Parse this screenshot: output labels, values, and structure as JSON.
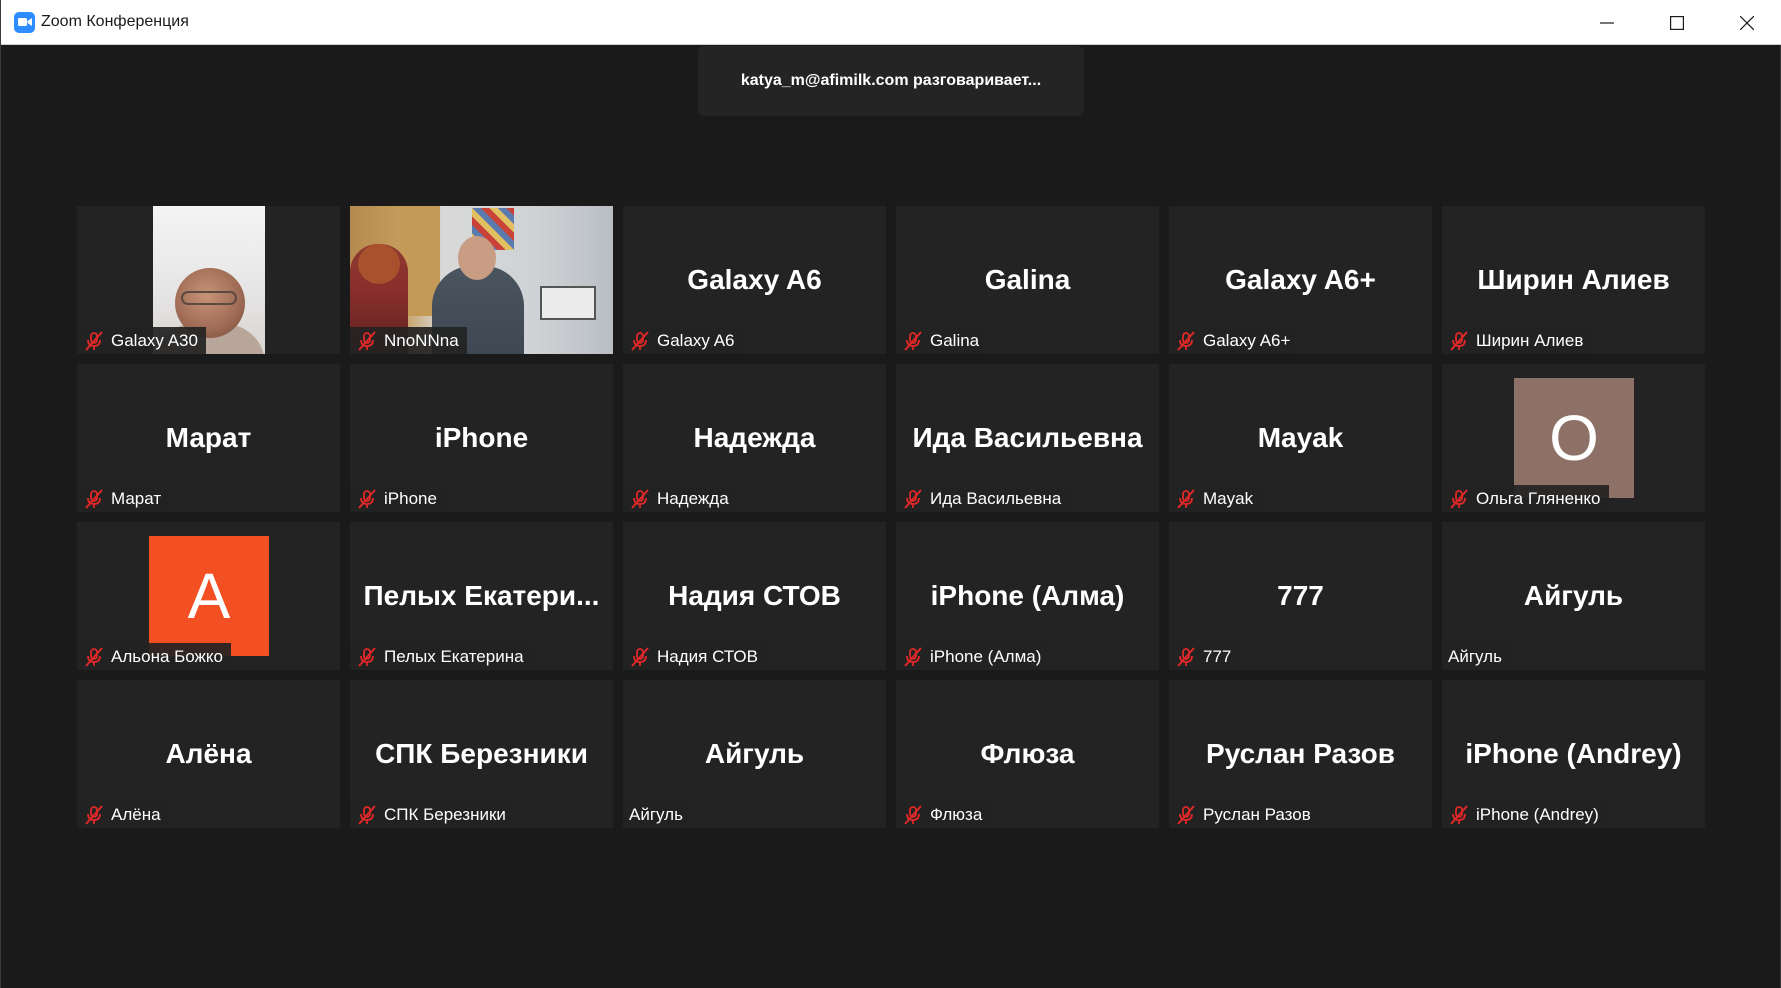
{
  "window": {
    "title": "Zoom Конференция",
    "accent_color": "#2d8cff",
    "icons": {
      "app": "zoom-camera-icon",
      "minimize": "minimize-icon",
      "maximize": "maximize-icon",
      "close": "close-icon"
    }
  },
  "talking_banner": {
    "text": "katya_m@afimilk.com разговаривает..."
  },
  "tiles": [
    {
      "center_name": "",
      "label": "Galaxy A30",
      "muted": true,
      "video": "video-1"
    },
    {
      "center_name": "",
      "label": "NnoNNna",
      "muted": true,
      "video": "video-2"
    },
    {
      "center_name": "Galaxy A6",
      "label": "Galaxy A6",
      "muted": true
    },
    {
      "center_name": "Galina",
      "label": "Galina",
      "muted": true
    },
    {
      "center_name": "Galaxy A6+",
      "label": "Galaxy A6+",
      "muted": true
    },
    {
      "center_name": "Ширин Алиев",
      "label": "Ширин Алиев",
      "muted": true
    },
    {
      "center_name": "Марат",
      "label": "Марат",
      "muted": true
    },
    {
      "center_name": "iPhone",
      "label": "iPhone",
      "muted": true
    },
    {
      "center_name": "Надежда",
      "label": "Надежда",
      "muted": true
    },
    {
      "center_name": "Ида Васильевна",
      "label": "Ида Васильевна",
      "muted": true
    },
    {
      "center_name": "Mayak",
      "label": "Mayak",
      "muted": true
    },
    {
      "center_name": "",
      "label": "Ольга Гляненко",
      "muted": true,
      "avatar_letter": "О",
      "avatar_color": "#8e7166"
    },
    {
      "center_name": "",
      "label": "Альона Божко",
      "muted": true,
      "avatar_letter": "A",
      "avatar_color": "#f25022"
    },
    {
      "center_name": "Пелых  Екатери...",
      "label": "Пелых Екатерина",
      "muted": true
    },
    {
      "center_name": "Надия СТОВ",
      "label": "Надия СТОВ",
      "muted": true
    },
    {
      "center_name": "iPhone (Алма)",
      "label": "iPhone (Алма)",
      "muted": true
    },
    {
      "center_name": "777",
      "label": "777",
      "muted": true
    },
    {
      "center_name": "Айгуль",
      "label": "Айгуль",
      "muted": false
    },
    {
      "center_name": "Алёна",
      "label": "Алёна",
      "muted": true
    },
    {
      "center_name": "СПК Березники",
      "label": "СПК Березники",
      "muted": true
    },
    {
      "center_name": "Айгуль",
      "label": "Айгуль",
      "muted": false
    },
    {
      "center_name": "Флюза",
      "label": "Флюза",
      "muted": true
    },
    {
      "center_name": "Руслан Разов",
      "label": "Руслан Разов",
      "muted": true
    },
    {
      "center_name": "iPhone (Andrey)",
      "label": "iPhone (Andrey)",
      "muted": true
    }
  ],
  "mute_icon_color": "#e02828"
}
